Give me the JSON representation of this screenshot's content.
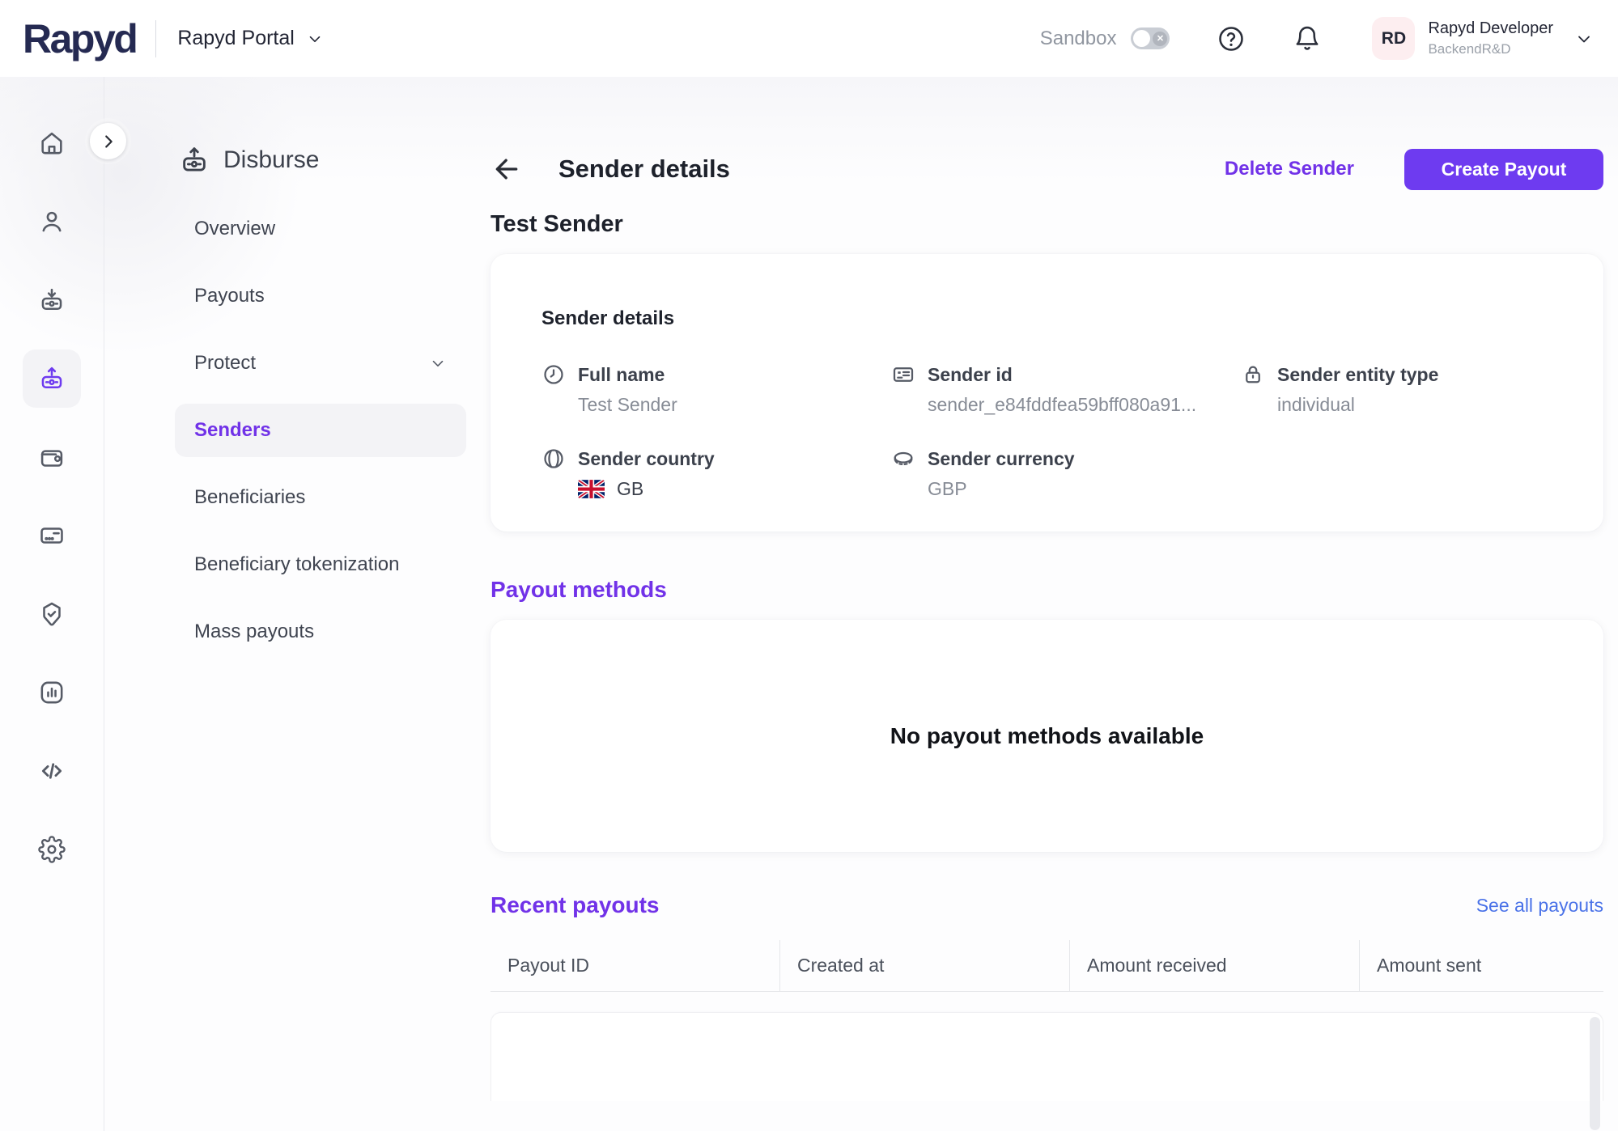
{
  "header": {
    "logo_text": "Rapyd",
    "portal_label": "Rapyd Portal",
    "sandbox_label": "Sandbox",
    "user": {
      "initials": "RD",
      "name": "Rapyd Developer",
      "org": "BackendR&D"
    }
  },
  "nav_rail": {
    "items": [
      {
        "name": "home"
      },
      {
        "name": "clients"
      },
      {
        "name": "collect"
      },
      {
        "name": "disburse",
        "active": true
      },
      {
        "name": "wallet"
      },
      {
        "name": "cards"
      },
      {
        "name": "compliance"
      },
      {
        "name": "reports"
      },
      {
        "name": "developers"
      },
      {
        "name": "settings"
      }
    ]
  },
  "sidebar": {
    "title": "Disburse",
    "items": [
      {
        "label": "Overview"
      },
      {
        "label": "Payouts"
      },
      {
        "label": "Protect",
        "has_chevron": true
      },
      {
        "label": "Senders",
        "active": true
      },
      {
        "label": "Beneficiaries"
      },
      {
        "label": "Beneficiary tokenization"
      },
      {
        "label": "Mass payouts"
      }
    ]
  },
  "page": {
    "title": "Sender details",
    "delete_label": "Delete Sender",
    "create_label": "Create Payout",
    "sender_name": "Test Sender",
    "details_card": {
      "heading": "Sender details",
      "fields": [
        {
          "icon": "clock-icon",
          "label": "Full name",
          "value": "Test Sender"
        },
        {
          "icon": "id-card-icon",
          "label": "Sender id",
          "value": "sender_e84fddfea59bff080a91..."
        },
        {
          "icon": "lock-icon",
          "label": "Sender entity type",
          "value": "individual"
        },
        {
          "icon": "globe-icon",
          "label": "Sender country",
          "value": "GB",
          "flag": "united-kingdom"
        },
        {
          "icon": "coin-icon",
          "label": "Sender currency",
          "value": "GBP"
        }
      ]
    },
    "payout_methods": {
      "heading": "Payout methods",
      "empty_text": "No payout methods available"
    },
    "recent_payouts": {
      "heading": "Recent payouts",
      "see_all_label": "See all payouts",
      "columns": [
        "Payout ID",
        "Created at",
        "Amount received",
        "Amount sent"
      ]
    }
  },
  "colors": {
    "brand_navy": "#252a52",
    "accent_purple": "#6e3bf0",
    "link_purple": "#7132e8",
    "link_blue": "#4a72e8",
    "avatar_bg": "#fdeef0"
  }
}
